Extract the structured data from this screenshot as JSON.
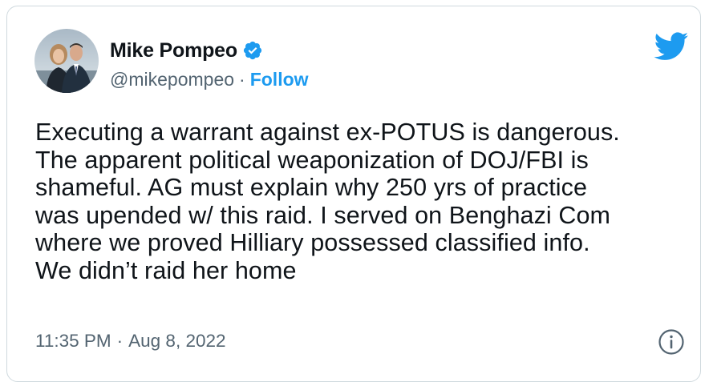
{
  "author": {
    "display_name": "Mike Pompeo",
    "handle": "@mikepompeo",
    "follow_label": "Follow",
    "separator": "·",
    "avatar_icon": "profile-photo-two-people"
  },
  "tweet": {
    "text": "Executing a warrant against ex-POTUS is dangerous.\nThe apparent political weaponization of DOJ/FBI is\nshameful. AG must explain why 250 yrs of practice\nwas upended w/ this raid. I served on Benghazi Com\nwhere we proved Hilliary possessed classified info.\nWe didn’t raid her home",
    "time": "11:35 PM",
    "date_separator": "·",
    "date": "Aug 8, 2022"
  },
  "icons": {
    "logo": "twitter-bird-icon",
    "verified": "verified-badge-icon",
    "info": "info-icon"
  },
  "colors": {
    "brand_blue": "#1d9bf0",
    "text_primary": "#0f1419",
    "text_secondary": "#536471",
    "border": "#cfd9de"
  }
}
